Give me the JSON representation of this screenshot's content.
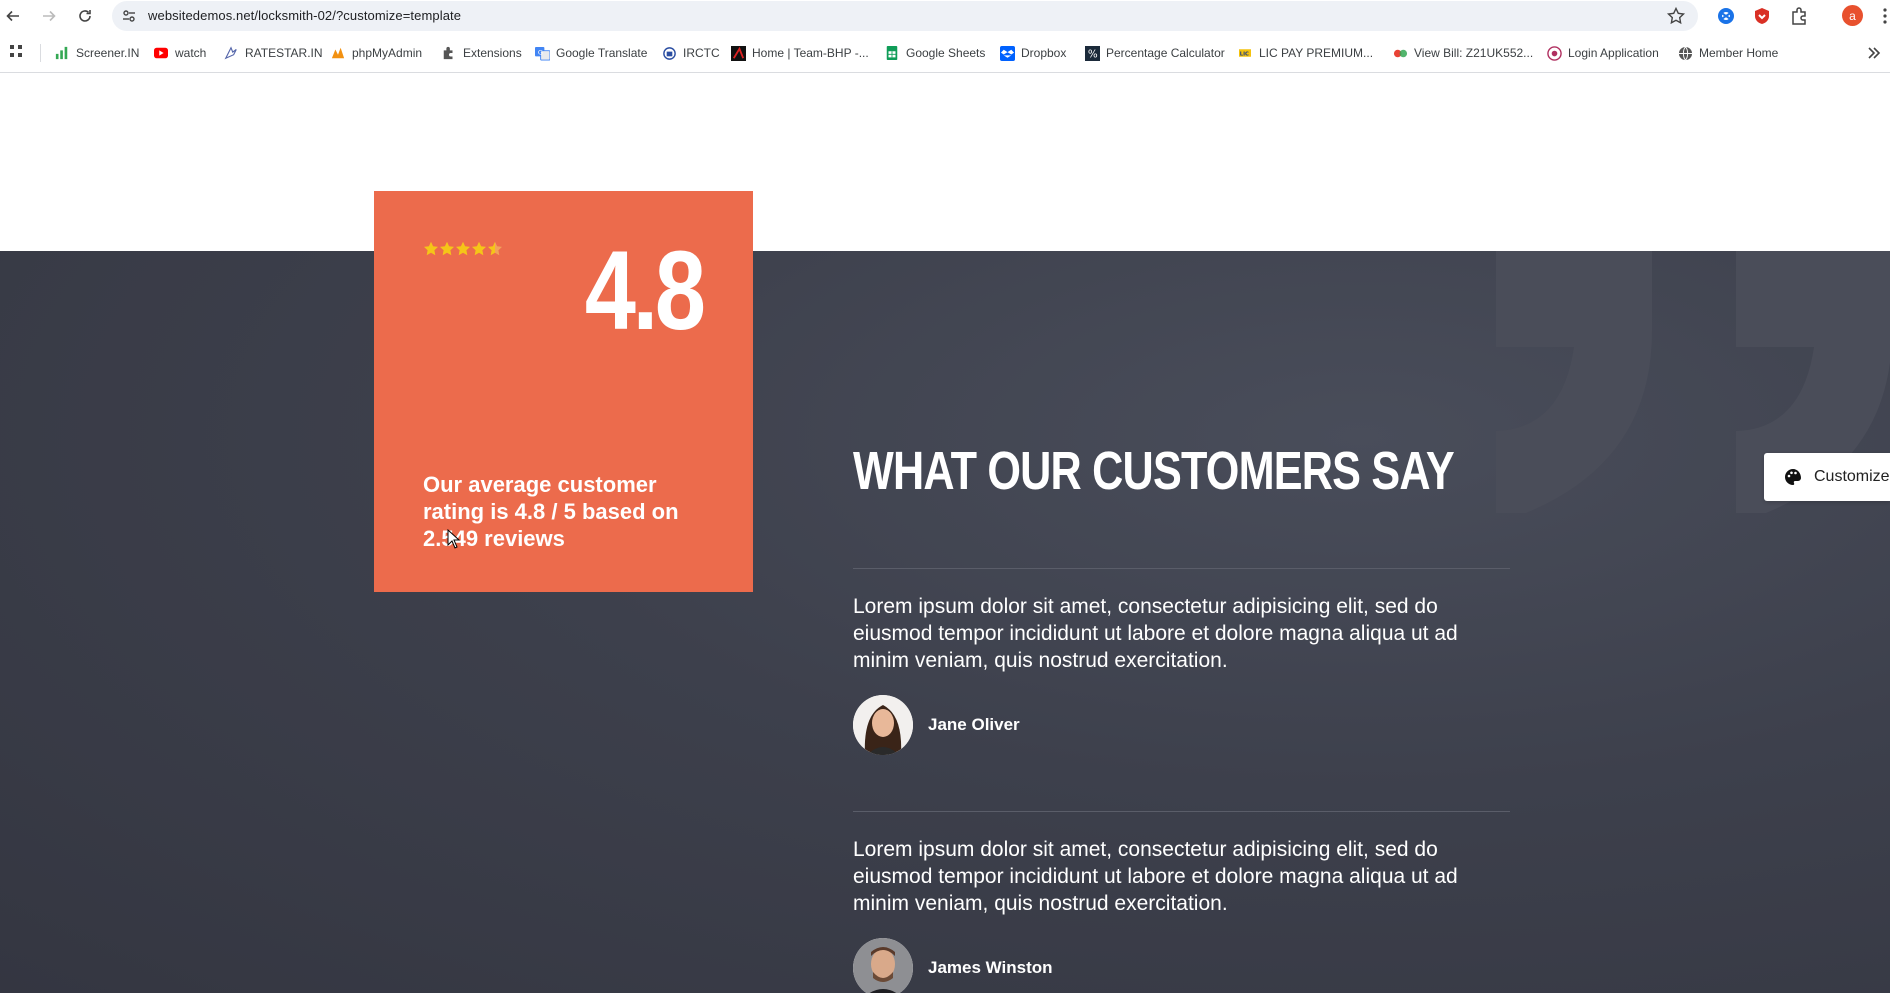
{
  "browser": {
    "url": "websitedemos.net/locksmith-02/?customize=template",
    "profile_initial": "a",
    "bookmarks": [
      {
        "label": "Screener.IN",
        "icon": "bar-chart-icon"
      },
      {
        "label": "watch",
        "icon": "youtube-icon"
      },
      {
        "label": "RATESTAR.IN",
        "icon": "ratestar-icon"
      },
      {
        "label": "phpMyAdmin",
        "icon": "phpmyadmin-icon"
      },
      {
        "label": "Extensions",
        "icon": "puzzle-icon"
      },
      {
        "label": "Google Translate",
        "icon": "translate-icon"
      },
      {
        "label": "IRCTC",
        "icon": "irctc-icon"
      },
      {
        "label": "Home | Team-BHP -...",
        "icon": "teambhp-icon"
      },
      {
        "label": "Google Sheets",
        "icon": "sheets-icon"
      },
      {
        "label": "Dropbox",
        "icon": "dropbox-icon"
      },
      {
        "label": "Percentage Calculator",
        "icon": "percent-icon"
      },
      {
        "label": "LIC PAY PREMIUM...",
        "icon": "lic-icon"
      },
      {
        "label": "View Bill: Z21UK552...",
        "icon": "bill-icon"
      },
      {
        "label": "Login Application",
        "icon": "login-app-icon"
      },
      {
        "label": "Member Home",
        "icon": "globe-icon"
      }
    ]
  },
  "rating_card": {
    "stars": 4.5,
    "stars_max": 5,
    "value": "4.8",
    "text": "Our average customer rating is 4.8 / 5 based on 2.549 reviews",
    "color": "#ec6b4c"
  },
  "testimonials_section": {
    "title": "WHAT OUR CUSTOMERS SAY",
    "items": [
      {
        "quote": "Lorem ipsum dolor sit amet, consectetur adipisicing elit, sed do eiusmod tempor incididunt ut labore et dolore magna aliqua ut ad minim veniam, quis nostrud exercitation.",
        "name": "Jane Oliver"
      },
      {
        "quote": "Lorem ipsum dolor sit amet, consectetur adipisicing elit, sed do eiusmod tempor incididunt ut labore et dolore magna aliqua ut ad minim veniam, quis nostrud exercitation.",
        "name": "James Winston"
      }
    ]
  },
  "customize_button": {
    "label": "Customize"
  }
}
